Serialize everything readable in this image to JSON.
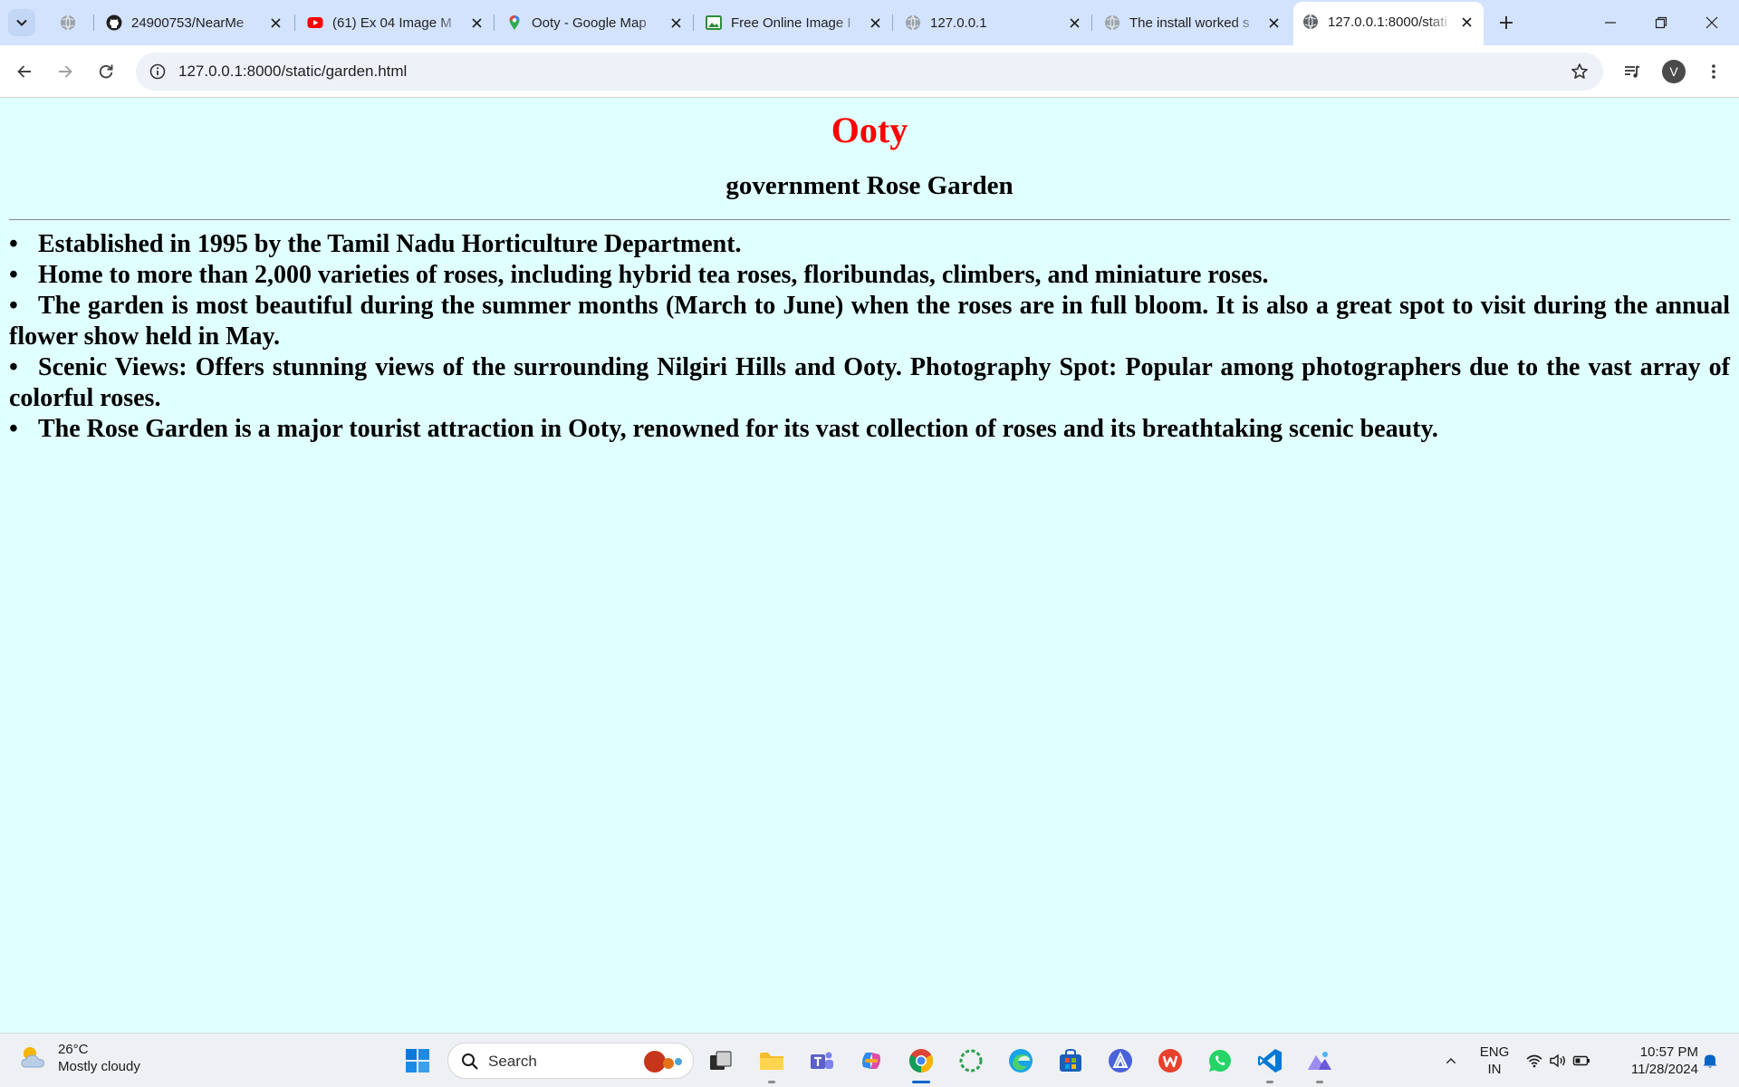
{
  "browser": {
    "tabs": [
      {
        "title": "",
        "icon": "globe-icon"
      },
      {
        "title": "24900753/NearMe",
        "icon": "github-icon"
      },
      {
        "title": "(61) Ex 04 Image M",
        "icon": "youtube-icon"
      },
      {
        "title": "Ooty - Google Map",
        "icon": "google-maps-icon"
      },
      {
        "title": "Free Online Image I",
        "icon": "image-icon"
      },
      {
        "title": "127.0.0.1",
        "icon": "globe-icon"
      },
      {
        "title": "The install worked s",
        "icon": "globe-icon"
      },
      {
        "title": "127.0.0.1:8000/stati",
        "icon": "globe-icon"
      }
    ],
    "address_bar": {
      "url": "127.0.0.1:8000/static/garden.html"
    },
    "profile_initial": "V"
  },
  "page": {
    "title": "Ooty",
    "subtitle": "government Rose Garden",
    "bullet": "•",
    "items": [
      "Established in 1995 by the Tamil Nadu Horticulture Department.",
      "Home to more than 2,000 varieties of roses, including hybrid tea roses, floribundas, climbers, and miniature roses.",
      "The garden is most beautiful during the summer months (March to June) when the roses are in full bloom. It is also a great spot to visit during the annual flower show held in May.",
      "Scenic Views: Offers stunning views of the surrounding Nilgiri Hills and Ooty. Photography Spot: Popular among photographers due to the vast array of colorful roses.",
      "The Rose Garden is a major tourist attraction in Ooty, renowned for its vast collection of roses and its breathtaking scenic beauty."
    ],
    "colors": {
      "background": "#e0ffff",
      "title": "#ff0000"
    }
  },
  "taskbar": {
    "weather": {
      "temp": "26°C",
      "condition": "Mostly cloudy"
    },
    "search_label": "Search",
    "tray": {
      "lang_line1": "ENG",
      "lang_line2": "IN",
      "time": "10:57 PM",
      "date": "11/28/2024"
    }
  }
}
